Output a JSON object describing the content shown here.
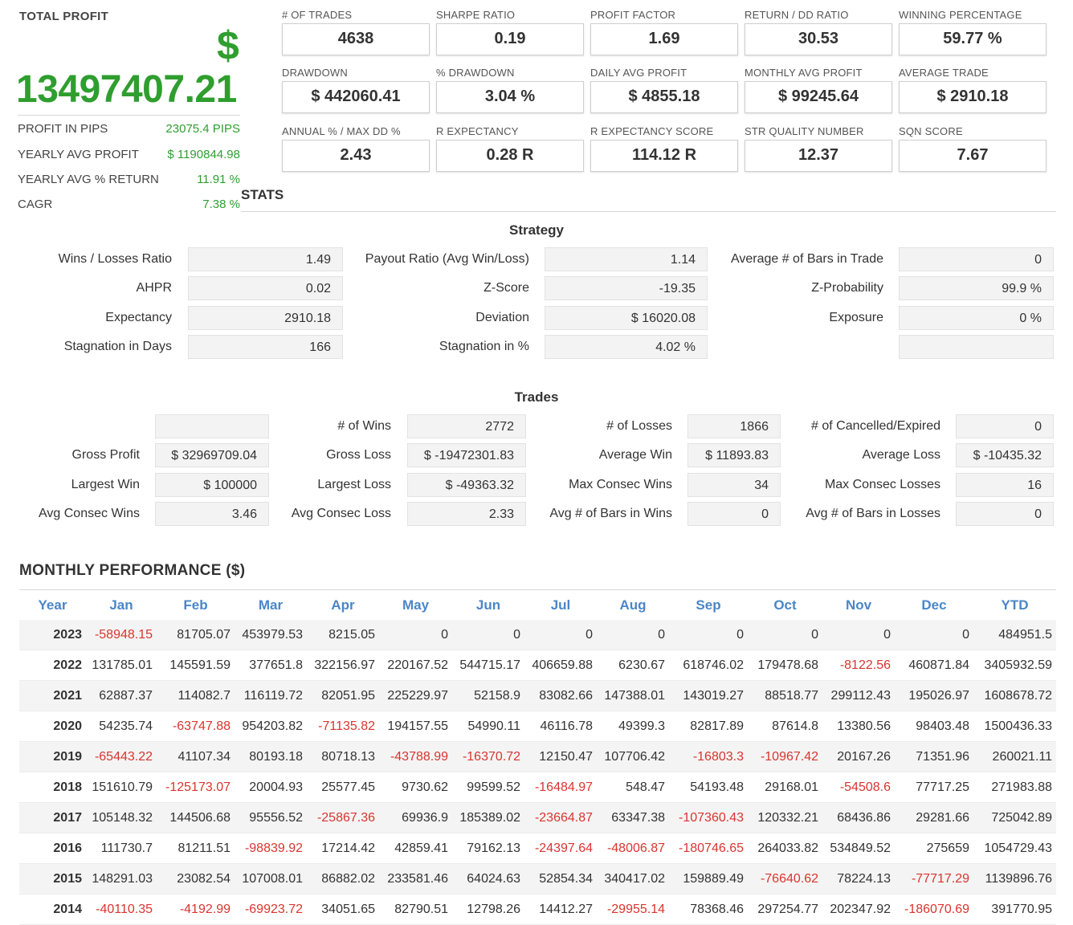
{
  "total_profit": {
    "title": "TOTAL PROFIT",
    "currency_symbol": "$",
    "value": "13497407.21",
    "rows": [
      {
        "label": "PROFIT IN PIPS",
        "value": "23075.4 PIPS"
      },
      {
        "label": "YEARLY AVG PROFIT",
        "value": "$ 1190844.98"
      },
      {
        "label": "YEARLY AVG % RETURN",
        "value": "11.91 %"
      },
      {
        "label": "CAGR",
        "value": "7.38 %"
      }
    ]
  },
  "metrics": [
    {
      "label": "# OF TRADES",
      "value": "4638"
    },
    {
      "label": "SHARPE RATIO",
      "value": "0.19"
    },
    {
      "label": "PROFIT FACTOR",
      "value": "1.69"
    },
    {
      "label": "RETURN / DD RATIO",
      "value": "30.53"
    },
    {
      "label": "WINNING PERCENTAGE",
      "value": "59.77 %"
    },
    {
      "label": "DRAWDOWN",
      "value": "$ 442060.41"
    },
    {
      "label": "% DRAWDOWN",
      "value": "3.04 %"
    },
    {
      "label": "DAILY AVG PROFIT",
      "value": "$ 4855.18"
    },
    {
      "label": "MONTHLY AVG PROFIT",
      "value": "$ 99245.64"
    },
    {
      "label": "AVERAGE TRADE",
      "value": "$ 2910.18"
    },
    {
      "label": "ANNUAL % / MAX DD %",
      "value": "2.43"
    },
    {
      "label": "R EXPECTANCY",
      "value": "0.28 R"
    },
    {
      "label": "R EXPECTANCY SCORE",
      "value": "114.12 R"
    },
    {
      "label": "STR QUALITY NUMBER",
      "value": "12.37"
    },
    {
      "label": "SQN SCORE",
      "value": "7.67"
    }
  ],
  "stats_label": "STATS",
  "strategy": {
    "title": "Strategy",
    "rows": [
      [
        {
          "label": "Wins / Losses Ratio",
          "value": "1.49"
        },
        {
          "label": "Payout Ratio (Avg Win/Loss)",
          "value": "1.14"
        },
        {
          "label": "Average # of Bars in Trade",
          "value": "0"
        }
      ],
      [
        {
          "label": "AHPR",
          "value": "0.02"
        },
        {
          "label": "Z-Score",
          "value": "-19.35"
        },
        {
          "label": "Z-Probability",
          "value": "99.9 %"
        }
      ],
      [
        {
          "label": "Expectancy",
          "value": "2910.18"
        },
        {
          "label": "Deviation",
          "value": "$ 16020.08"
        },
        {
          "label": "Exposure",
          "value": "0 %"
        }
      ],
      [
        {
          "label": "Stagnation in Days",
          "value": "166"
        },
        {
          "label": "Stagnation in %",
          "value": "4.02 %"
        },
        {
          "label": "",
          "value": ""
        }
      ]
    ]
  },
  "trades": {
    "title": "Trades",
    "rows": [
      [
        {
          "label": "",
          "value": ""
        },
        {
          "label": "# of Wins",
          "value": "2772"
        },
        {
          "label": "# of Losses",
          "value": "1866"
        },
        {
          "label": "# of Cancelled/Expired",
          "value": "0"
        }
      ],
      [
        {
          "label": "Gross Profit",
          "value": "$ 32969709.04"
        },
        {
          "label": "Gross Loss",
          "value": "$ -19472301.83"
        },
        {
          "label": "Average Win",
          "value": "$ 11893.83"
        },
        {
          "label": "Average Loss",
          "value": "$ -10435.32"
        }
      ],
      [
        {
          "label": "Largest Win",
          "value": "$ 100000"
        },
        {
          "label": "Largest Loss",
          "value": "$ -49363.32"
        },
        {
          "label": "Max Consec Wins",
          "value": "34"
        },
        {
          "label": "Max Consec Losses",
          "value": "16"
        }
      ],
      [
        {
          "label": "Avg Consec Wins",
          "value": "3.46"
        },
        {
          "label": "Avg Consec Loss",
          "value": "2.33"
        },
        {
          "label": "Avg # of Bars in Wins",
          "value": "0"
        },
        {
          "label": "Avg # of Bars in Losses",
          "value": "0"
        }
      ]
    ]
  },
  "monthly": {
    "title": "MONTHLY PERFORMANCE ($)",
    "headers": [
      "Year",
      "Jan",
      "Feb",
      "Mar",
      "Apr",
      "May",
      "Jun",
      "Jul",
      "Aug",
      "Sep",
      "Oct",
      "Nov",
      "Dec",
      "YTD"
    ],
    "rows": [
      [
        "2023",
        "-58948.15",
        "81705.07",
        "453979.53",
        "8215.05",
        "0",
        "0",
        "0",
        "0",
        "0",
        "0",
        "0",
        "0",
        "484951.5"
      ],
      [
        "2022",
        "131785.01",
        "145591.59",
        "377651.8",
        "322156.97",
        "220167.52",
        "544715.17",
        "406659.88",
        "6230.67",
        "618746.02",
        "179478.68",
        "-8122.56",
        "460871.84",
        "3405932.59"
      ],
      [
        "2021",
        "62887.37",
        "114082.7",
        "116119.72",
        "82051.95",
        "225229.97",
        "52158.9",
        "83082.66",
        "147388.01",
        "143019.27",
        "88518.77",
        "299112.43",
        "195026.97",
        "1608678.72"
      ],
      [
        "2020",
        "54235.74",
        "-63747.88",
        "954203.82",
        "-71135.82",
        "194157.55",
        "54990.11",
        "46116.78",
        "49399.3",
        "82817.89",
        "87614.8",
        "13380.56",
        "98403.48",
        "1500436.33"
      ],
      [
        "2019",
        "-65443.22",
        "41107.34",
        "80193.18",
        "80718.13",
        "-43788.99",
        "-16370.72",
        "12150.47",
        "107706.42",
        "-16803.3",
        "-10967.42",
        "20167.26",
        "71351.96",
        "260021.11"
      ],
      [
        "2018",
        "151610.79",
        "-125173.07",
        "20004.93",
        "25577.45",
        "9730.62",
        "99599.52",
        "-16484.97",
        "548.47",
        "54193.48",
        "29168.01",
        "-54508.6",
        "77717.25",
        "271983.88"
      ],
      [
        "2017",
        "105148.32",
        "144506.68",
        "95556.52",
        "-25867.36",
        "69936.9",
        "185389.02",
        "-23664.87",
        "63347.38",
        "-107360.43",
        "120332.21",
        "68436.86",
        "29281.66",
        "725042.89"
      ],
      [
        "2016",
        "111730.7",
        "81211.51",
        "-98839.92",
        "17214.42",
        "42859.41",
        "79162.13",
        "-24397.64",
        "-48006.87",
        "-180746.65",
        "264033.82",
        "534849.52",
        "275659",
        "1054729.43"
      ],
      [
        "2015",
        "148291.03",
        "23082.54",
        "107008.01",
        "86882.02",
        "233581.46",
        "64024.63",
        "52854.34",
        "340417.02",
        "159889.49",
        "-76640.62",
        "78224.13",
        "-77717.29",
        "1139896.76"
      ],
      [
        "2014",
        "-40110.35",
        "-4192.99",
        "-69923.72",
        "34051.65",
        "82790.51",
        "12798.26",
        "14412.27",
        "-29955.14",
        "78368.46",
        "297254.77",
        "202347.92",
        "-186070.69",
        "391770.95"
      ]
    ]
  },
  "colors": {
    "positive": "#2f9e2f",
    "negative": "#d9352f",
    "header_blue": "#4a86c8"
  }
}
